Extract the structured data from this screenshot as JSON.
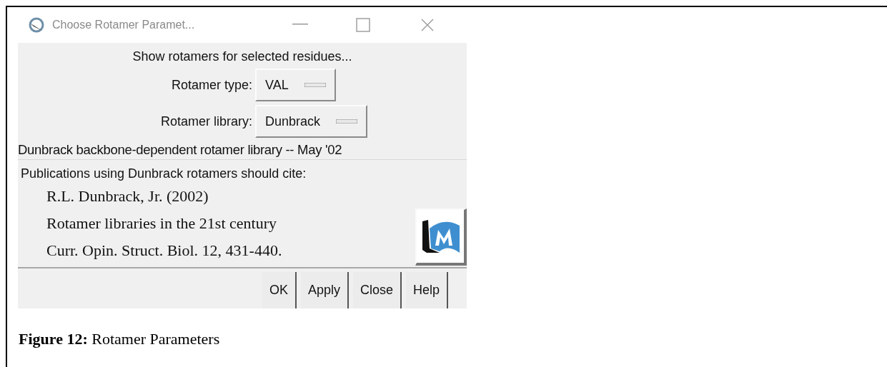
{
  "window": {
    "title": "Choose Rotamer Paramet..."
  },
  "heading": "Show rotamers for selected residues...",
  "options": [
    {
      "label": "Rotamer type:",
      "value": "VAL"
    },
    {
      "label": "Rotamer library:",
      "value": "Dunbrack"
    }
  ],
  "library_description": "Dunbrack backbone-dependent rotamer library -- May '02",
  "citation_note": "Publications using Dunbrack rotamers should cite:",
  "citation_lines": [
    "R.L. Dunbrack, Jr. (2002)",
    "Rotamer libraries in the 21st century",
    "Curr. Opin. Struct. Biol. 12, 431-440."
  ],
  "buttons": [
    "OK",
    "Apply",
    "Close",
    "Help"
  ],
  "caption": "**Figure 12:** Rotamer Parameters"
}
